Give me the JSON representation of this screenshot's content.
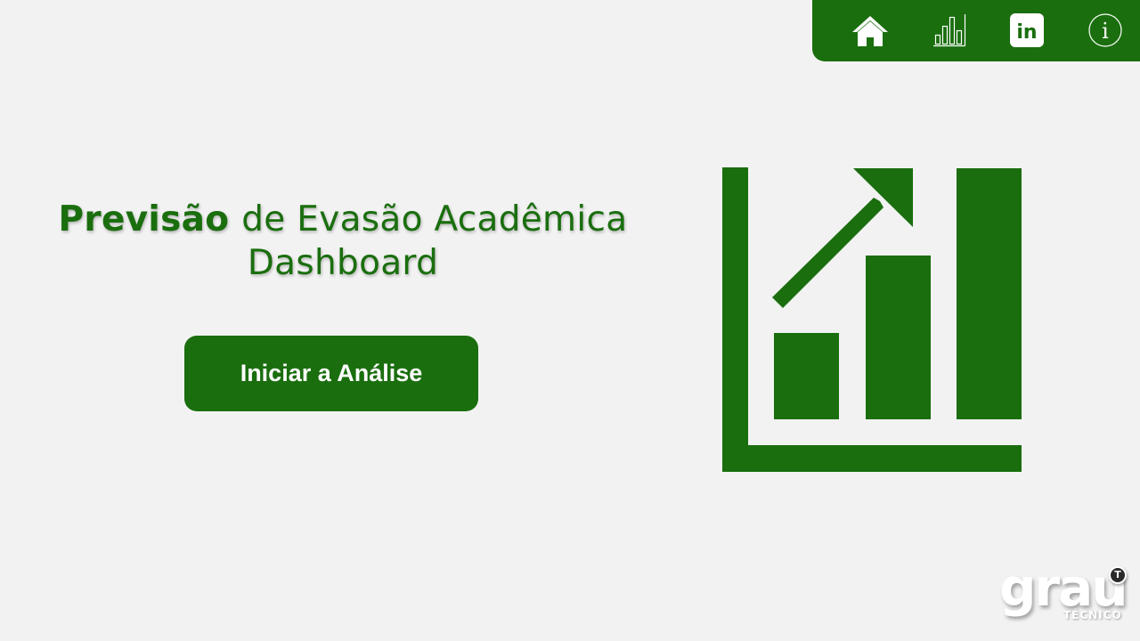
{
  "nav": {
    "items": [
      {
        "icon": "home-icon"
      },
      {
        "icon": "bar-chart-icon"
      },
      {
        "icon": "linkedin-icon",
        "label": "in"
      },
      {
        "icon": "info-icon",
        "label": "i"
      }
    ]
  },
  "title": {
    "bold": "Previsão",
    "rest_line1": "de Evasão Acadêmica",
    "line2": "Dashboard"
  },
  "start_button": {
    "label": "Iniciar a Análise"
  },
  "hero": {
    "icon": "growth-chart-icon"
  },
  "logo": {
    "word": "grau",
    "sub": "TÉCNICO",
    "badge": "T"
  },
  "colors": {
    "accent": "#1a6e0e",
    "background": "#f2f2f2",
    "text_on_accent": "#ffffff"
  }
}
